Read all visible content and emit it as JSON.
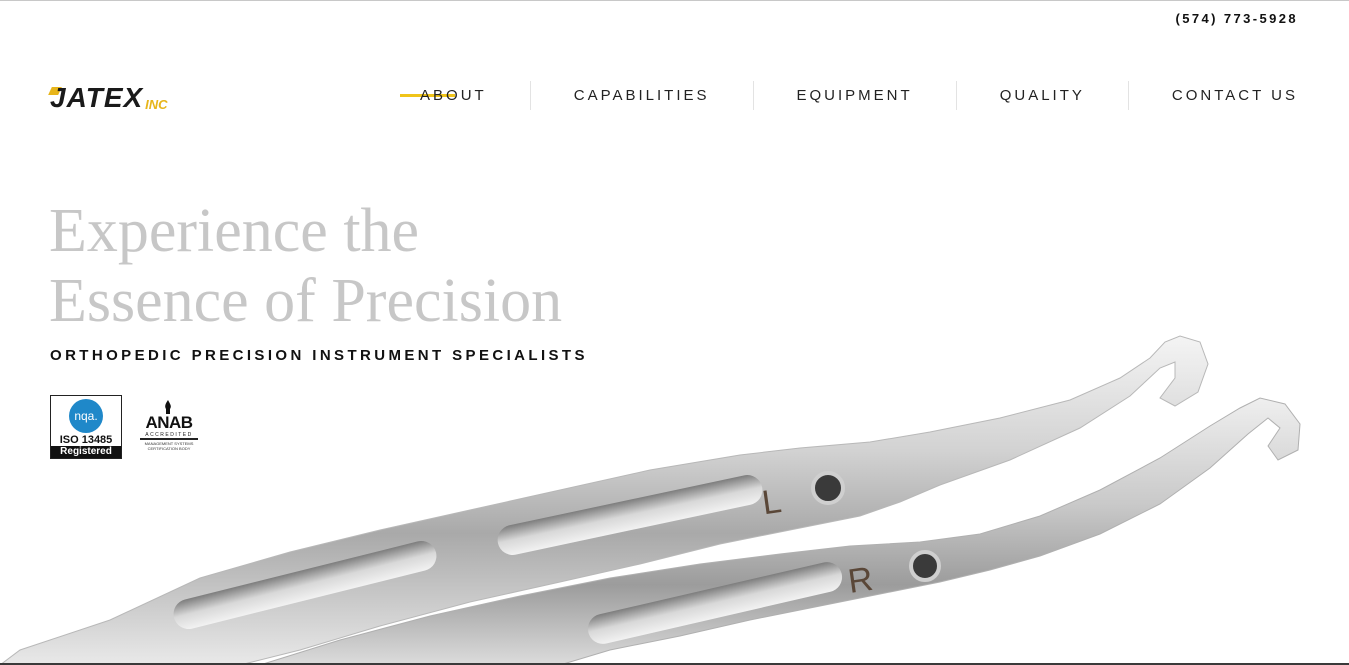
{
  "header": {
    "phone": "(574) 773-5928",
    "logo": {
      "text": "JATEX",
      "suffix": "INC"
    },
    "nav": [
      {
        "label": "ABOUT",
        "active": true
      },
      {
        "label": "CAPABILITIES",
        "active": false
      },
      {
        "label": "EQUIPMENT",
        "active": false
      },
      {
        "label": "QUALITY",
        "active": false
      },
      {
        "label": "CONTACT US",
        "active": false
      }
    ]
  },
  "hero": {
    "title_line1": "Experience the",
    "title_line2": "Essence of Precision",
    "subtitle": "ORTHOPEDIC PRECISION INSTRUMENT SPECIALISTS",
    "instrument_marks": {
      "left": "L",
      "right": "R"
    }
  },
  "certifications": {
    "nqa": {
      "logo_text": "nqa.",
      "standard": "ISO 13485",
      "status": "Registered"
    },
    "anab": {
      "name": "ANAB",
      "tagline": "ACCREDITED",
      "fine_print": "MANAGEMENT SYSTEMS CERTIFICATION BODY"
    }
  },
  "colors": {
    "accent": "#f0c419",
    "title_gray": "#c7c7c7",
    "text": "#111111"
  }
}
